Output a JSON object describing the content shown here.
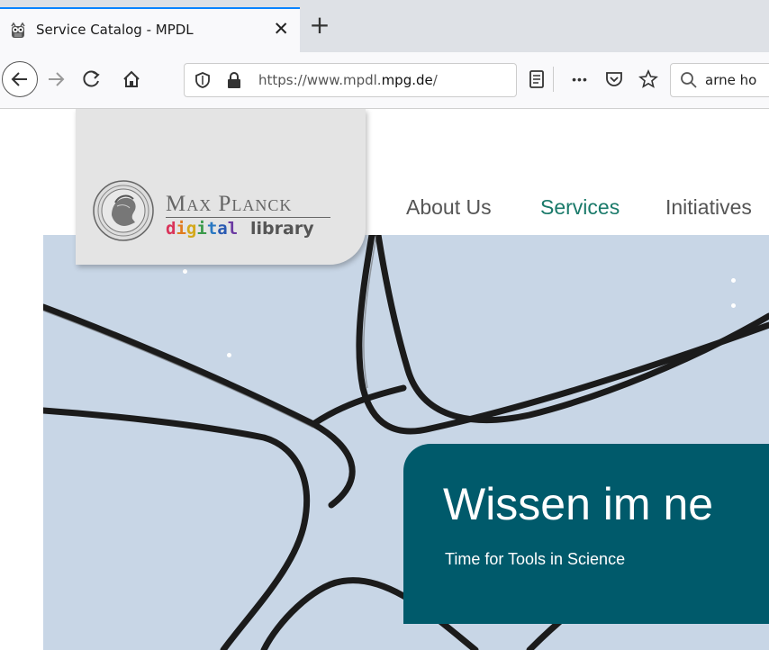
{
  "browser": {
    "tab": {
      "title": "Service Catalog - MPDL",
      "close_glyph": "✕",
      "favicon": "owl-icon"
    },
    "new_tab_glyph": "+",
    "url": {
      "prefix": "https://www.mpdl.",
      "host": "mpg.de",
      "suffix": "/"
    },
    "overflow_glyph": "•••",
    "search_value": "arne ho",
    "icons": [
      "back-arrow-icon",
      "forward-arrow-icon",
      "reload-icon",
      "home-icon",
      "shield-icon",
      "lock-icon",
      "reader-view-icon",
      "page-actions-icon",
      "pocket-icon",
      "bookmark-star-icon",
      "search-icon"
    ]
  },
  "site": {
    "logo": {
      "line1": "Max Planck",
      "line2_a": "digital",
      "line2_b": "library"
    },
    "menu": [
      {
        "label": "About Us",
        "color": "#555555"
      },
      {
        "label": "Services",
        "color": "#1a7a6a"
      },
      {
        "label": "Initiatives",
        "color": "#555555"
      }
    ],
    "hero": {
      "title": "Wissen im ne",
      "subtitle": "Time for Tools in Science"
    },
    "colors": {
      "accent_teal": "#005a6b",
      "hero_bg": "#c8d6e6"
    }
  }
}
